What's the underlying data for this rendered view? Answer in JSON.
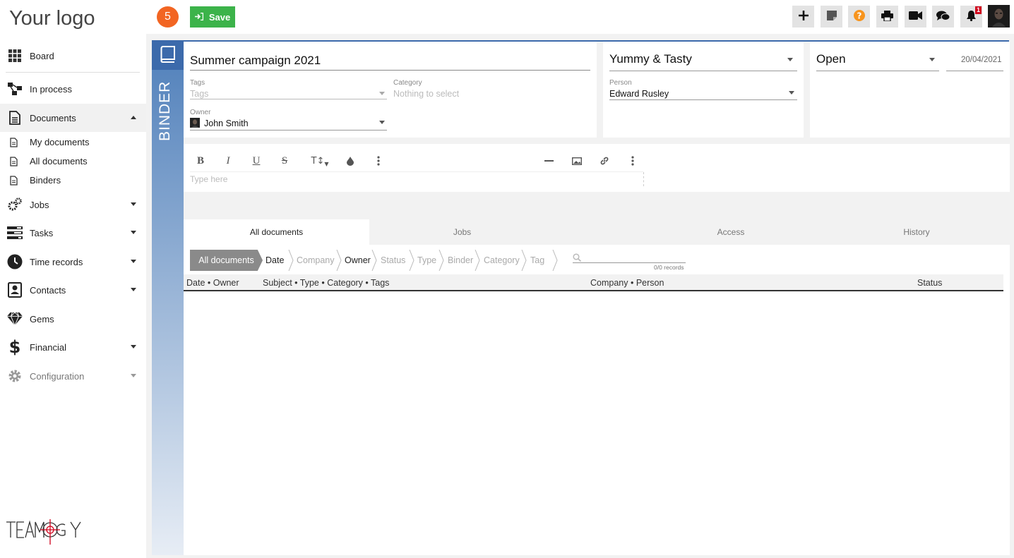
{
  "app": {
    "logo": "Your logo",
    "step_badge": "5",
    "save_label": "Save",
    "notif_count": "1"
  },
  "sidebar": {
    "items": [
      {
        "label": "Board"
      },
      {
        "label": "In process"
      },
      {
        "label": "Documents"
      },
      {
        "label": "My documents"
      },
      {
        "label": "All documents"
      },
      {
        "label": "Binders"
      },
      {
        "label": "Jobs"
      },
      {
        "label": "Tasks"
      },
      {
        "label": "Time records"
      },
      {
        "label": "Contacts"
      },
      {
        "label": "Gems"
      },
      {
        "label": "Financial"
      },
      {
        "label": "Configuration"
      }
    ]
  },
  "binder": {
    "side_label": "BINDER",
    "title": "Summer campaign 2021",
    "tags_label": "Tags",
    "tags_placeholder": "Tags",
    "category_label": "Category",
    "category_placeholder": "Nothing to select",
    "owner_label": "Owner",
    "owner_value": "John Smith",
    "company": "Yummy & Tasty",
    "person_label": "Person",
    "person_value": "Edward Rusley",
    "status": "Open",
    "date": "20/04/2021",
    "editor_placeholder": "Type here"
  },
  "tabs": [
    {
      "label": "All documents"
    },
    {
      "label": "Jobs"
    },
    {
      "label": "Access"
    },
    {
      "label": "History"
    }
  ],
  "filters": [
    {
      "label": "All documents"
    },
    {
      "label": "Date"
    },
    {
      "label": "Company"
    },
    {
      "label": "Owner"
    },
    {
      "label": "Status"
    },
    {
      "label": "Type"
    },
    {
      "label": "Binder"
    },
    {
      "label": "Category"
    },
    {
      "label": "Tag"
    }
  ],
  "search": {
    "records": "0/0 records"
  },
  "table": {
    "columns": [
      "Date • Owner",
      "Subject • Type • Category • Tags",
      "Company • Person",
      "Status"
    ]
  },
  "colors": {
    "accent": "#3c6aab",
    "save": "#3cb34a",
    "badge": "#f26522"
  }
}
